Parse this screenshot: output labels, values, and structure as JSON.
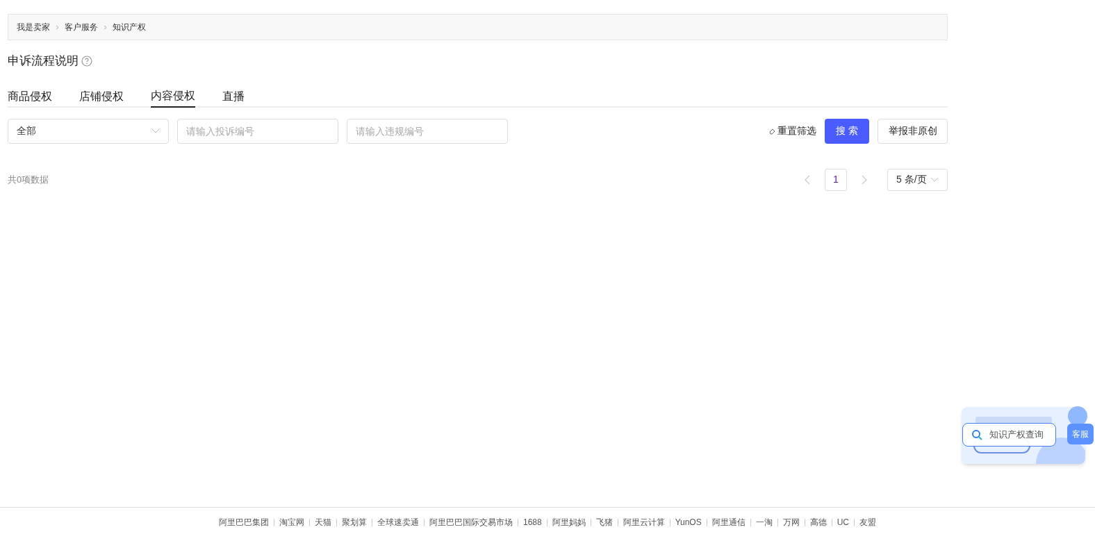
{
  "breadcrumb": [
    "我是卖家",
    "客户服务",
    "知识产权"
  ],
  "page_title": "申诉流程说明",
  "tabs": [
    {
      "label": "商品侵权",
      "selected": false
    },
    {
      "label": "店铺侵权",
      "selected": false
    },
    {
      "label": "内容侵权",
      "selected": true
    },
    {
      "label": "直播",
      "selected": false
    }
  ],
  "filters": {
    "status_select": "全部",
    "complaint_no": {
      "placeholder": "请输入投诉编号"
    },
    "violation_no": {
      "placeholder": "请输入违规编号"
    },
    "reset": "重置筛选",
    "search": "搜 索",
    "report": "举报非原创"
  },
  "total": "共0项数据",
  "pagination": {
    "pages": [
      {
        "label": "1",
        "selected": true
      }
    ],
    "page_size": "5 条/页"
  },
  "float_widget": {
    "query": "知识产权查询",
    "service": "客服"
  },
  "footer_links": [
    "阿里巴巴集团",
    "淘宝网",
    "天猫",
    "聚划算",
    "全球速卖通",
    "阿里巴巴国际交易市场",
    "1688",
    "阿里妈妈",
    "飞猪",
    "阿里云计算",
    "YunOS",
    "阿里通信",
    "一淘",
    "万网",
    "高德",
    "UC",
    "友盟"
  ]
}
